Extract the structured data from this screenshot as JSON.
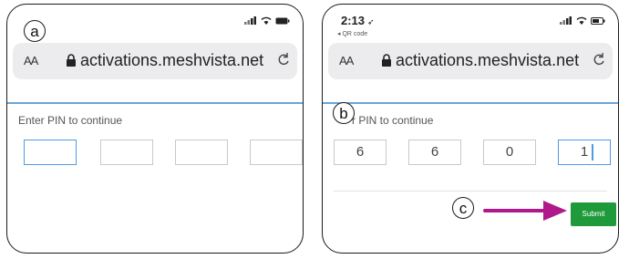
{
  "callouts": {
    "a": "a",
    "b": "b",
    "c": "c"
  },
  "colors": {
    "arrow": "#b0198a",
    "submit_bg": "#1e9a3b",
    "focus_border": "#4f9be0",
    "divider": "#6aa5d8"
  },
  "left_phone": {
    "url": "activations.meshvista.net",
    "aa": "AA",
    "reload_icon": "reload-icon",
    "prompt": "Enter PIN to continue",
    "pin_values": [
      "",
      "",
      "",
      ""
    ]
  },
  "right_phone": {
    "time": "2:13",
    "back_link": "◂ QR code",
    "aa": "AA",
    "url": "activations.meshvista.net",
    "prompt": "r PIN to continue",
    "pin_values": [
      "6",
      "6",
      "0",
      "1"
    ],
    "submit_label": "Submit"
  }
}
